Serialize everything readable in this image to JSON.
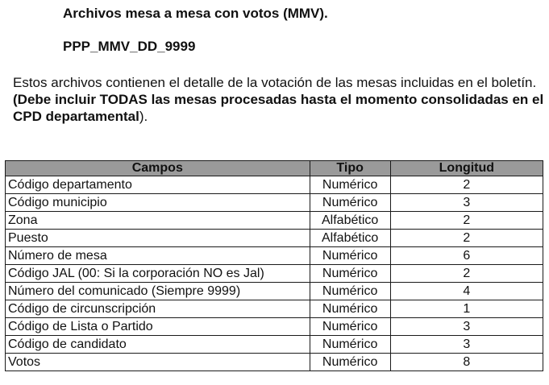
{
  "title": "Archivos mesa a mesa con votos (MMV).",
  "filename": "PPP_MMV_DD_9999",
  "description": {
    "normal": "Estos archivos contienen el detalle de  la votación de las mesas incluidas en el boletín. ",
    "bold": "(Debe incluir TODAS las mesas procesadas hasta el momento consolidadas en el CPD departamental",
    "tail": ")."
  },
  "table": {
    "headers": [
      "Campos",
      "Tipo",
      "Longitud"
    ],
    "rows": [
      {
        "campo": "Código departamento",
        "tipo": "Numérico",
        "longitud": "2"
      },
      {
        "campo": "Código municipio",
        "tipo": "Numérico",
        "longitud": "3"
      },
      {
        "campo": "Zona",
        "tipo": "Alfabético",
        "longitud": "2"
      },
      {
        "campo": "Puesto",
        "tipo": "Alfabético",
        "longitud": "2"
      },
      {
        "campo": "Número de mesa",
        "tipo": "Numérico",
        "longitud": "6"
      },
      {
        "campo": "Código JAL (00: Si la corporación NO es Jal)",
        "tipo": "Numérico",
        "longitud": "2"
      },
      {
        "campo": "Número del comunicado (Siempre 9999)",
        "tipo": "Numérico",
        "longitud": "4"
      },
      {
        "campo": "Código de circunscripción",
        "tipo": "Numérico",
        "longitud": "1"
      },
      {
        "campo": "Código de Lista o Partido",
        "tipo": "Numérico",
        "longitud": "3"
      },
      {
        "campo": "Código de candidato",
        "tipo": "Numérico",
        "longitud": "3"
      },
      {
        "campo": "Votos",
        "tipo": "Numérico",
        "longitud": "8"
      }
    ]
  }
}
